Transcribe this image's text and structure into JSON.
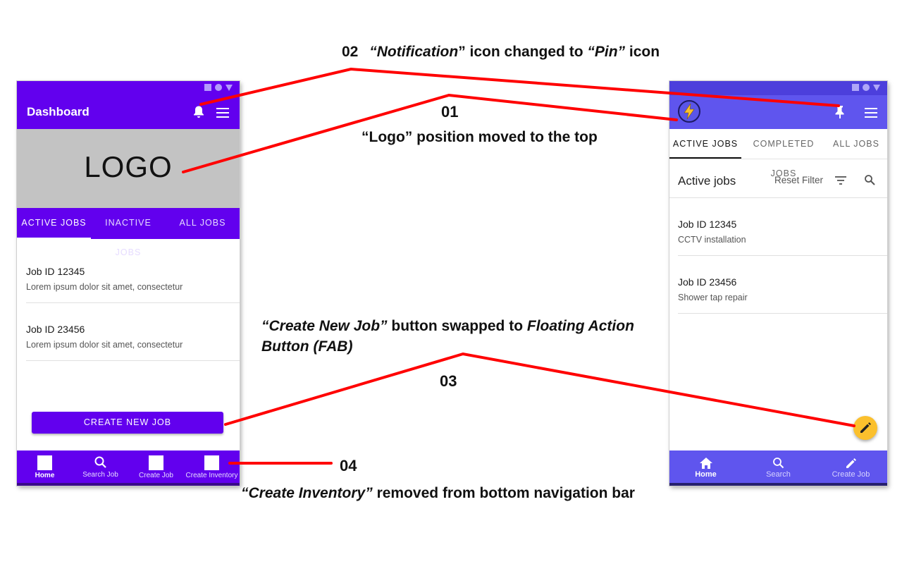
{
  "colors": {
    "old_primary": "#6200ee",
    "new_primary": "#5f55ee",
    "fab": "#fbc02d",
    "annotation_line": "#ff0000"
  },
  "annotations": {
    "a02": {
      "num": "02",
      "pre": "“",
      "em1": "Notification",
      "mid": "” icon changed to ",
      "em2": "“Pin”",
      "post": " icon"
    },
    "a01": {
      "num": "01",
      "text": "“Logo” position moved to the top"
    },
    "a03": {
      "line1_em": "“Create New Job”",
      "line1_mid": " button swapped to ",
      "line1_em2": "Floating Action",
      "line2_em": "Button (FAB)",
      "num": "03"
    },
    "a04": {
      "num": "04",
      "em": "“Create Inventory”",
      "text": " removed from bottom navigation bar"
    }
  },
  "phone_old": {
    "title": "Dashboard",
    "logo_text": "LOGO",
    "tabs": [
      "ACTIVE JOBS",
      "INACTIVE JOBS",
      "ALL JOBS"
    ],
    "jobs": [
      {
        "id": "Job ID 12345",
        "desc": "Lorem ipsum dolor sit amet, consectetur"
      },
      {
        "id": "Job ID 23456",
        "desc": "Lorem ipsum dolor sit amet, consectetur"
      }
    ],
    "create_button": "CREATE NEW JOB",
    "bottom_nav": [
      "Home",
      "Search Job",
      "Create Job",
      "Create Inventory"
    ]
  },
  "phone_new": {
    "tabs": [
      "ACTIVE JOBS",
      "COMPLETED JOBS",
      "ALL JOBS"
    ],
    "header_title": "Active jobs",
    "reset_filter": "Reset Filter",
    "jobs": [
      {
        "id": "Job ID 12345",
        "desc": "CCTV installation"
      },
      {
        "id": "Job ID 23456",
        "desc": "Shower tap repair"
      }
    ],
    "bottom_nav": [
      "Home",
      "Search",
      "Create Job"
    ],
    "icons": [
      "lightning-logo-icon",
      "pin-icon",
      "menu-icon",
      "filter-icon",
      "search-icon",
      "pencil-icon",
      "home-icon"
    ]
  }
}
